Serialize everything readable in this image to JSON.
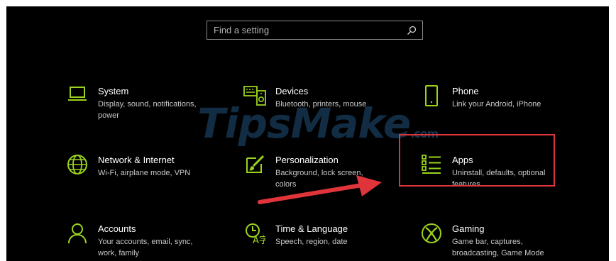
{
  "search": {
    "placeholder": "Find a setting",
    "icon": "search-icon"
  },
  "accent": "#9bd31c",
  "tiles": [
    {
      "title": "System",
      "desc": "Display, sound, notifications, power",
      "icon": "laptop-icon"
    },
    {
      "title": "Devices",
      "desc": "Bluetooth, printers, mouse",
      "icon": "keyboard-speaker-icon"
    },
    {
      "title": "Phone",
      "desc": "Link your Android, iPhone",
      "icon": "phone-icon"
    },
    {
      "title": "Network & Internet",
      "desc": "Wi-Fi, airplane mode, VPN",
      "icon": "globe-icon"
    },
    {
      "title": "Personalization",
      "desc": "Background, lock screen, colors",
      "icon": "paint-brush-icon"
    },
    {
      "title": "Apps",
      "desc": "Uninstall, defaults, optional features",
      "icon": "apps-list-icon"
    },
    {
      "title": "Accounts",
      "desc": "Your accounts, email, sync, work, family",
      "icon": "person-icon"
    },
    {
      "title": "Time & Language",
      "desc": "Speech, region, date",
      "icon": "time-language-icon"
    },
    {
      "title": "Gaming",
      "desc": "Game bar, captures, broadcasting, Game Mode",
      "icon": "xbox-icon"
    }
  ],
  "watermark": {
    "text": "TipsMake",
    "suffix": ".com"
  },
  "annotation": {
    "highlight_color": "#e0343b"
  }
}
